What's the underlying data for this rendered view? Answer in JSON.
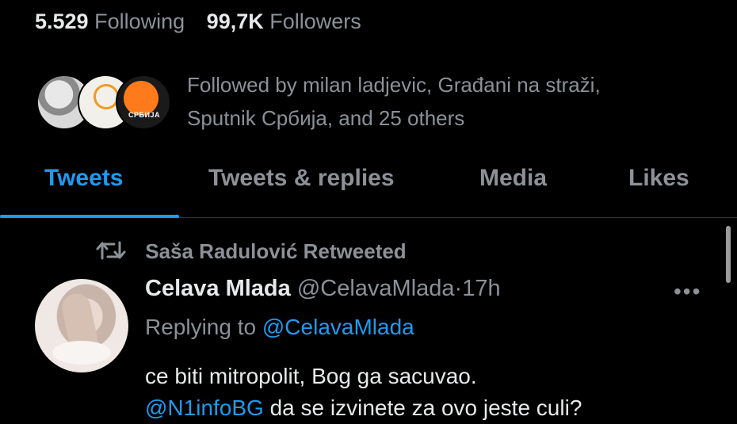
{
  "stats": {
    "following_count": "5.529",
    "following_label": "Following",
    "followers_count": "99,7K",
    "followers_label": "Followers"
  },
  "followed_by": {
    "text_line1": "Followed by milan ladjevic, Građani na straži,",
    "text_line2": "Sputnik Србија, and 25 others",
    "avatar3_label": "СРБИЈА"
  },
  "tabs": [
    {
      "label": "Tweets",
      "active": true
    },
    {
      "label": "Tweets & replies",
      "active": false
    },
    {
      "label": "Media",
      "active": false
    },
    {
      "label": "Likes",
      "active": false
    }
  ],
  "tweet": {
    "retweeted_by": "Saša Radulović Retweeted",
    "author_name": "Celava Mlada",
    "author_handle": "@CelavaMlada",
    "separator": "·",
    "time": "17h",
    "replying_prefix": "Replying to ",
    "replying_to": "@CelavaMlada",
    "body_line1": "ce biti mitropolit, Bog ga sacuvao.",
    "body_mention": "@N1infoBG",
    "body_line2_rest": " da se izvinete za ovo jeste culi?"
  },
  "icons": {
    "retweet": "retweet-icon",
    "more": "more-icon"
  },
  "colors": {
    "background": "#000000",
    "text_primary": "#e7e9ea",
    "text_secondary": "#8b9197",
    "accent": "#1d9bf0",
    "divider": "#2f3336"
  }
}
